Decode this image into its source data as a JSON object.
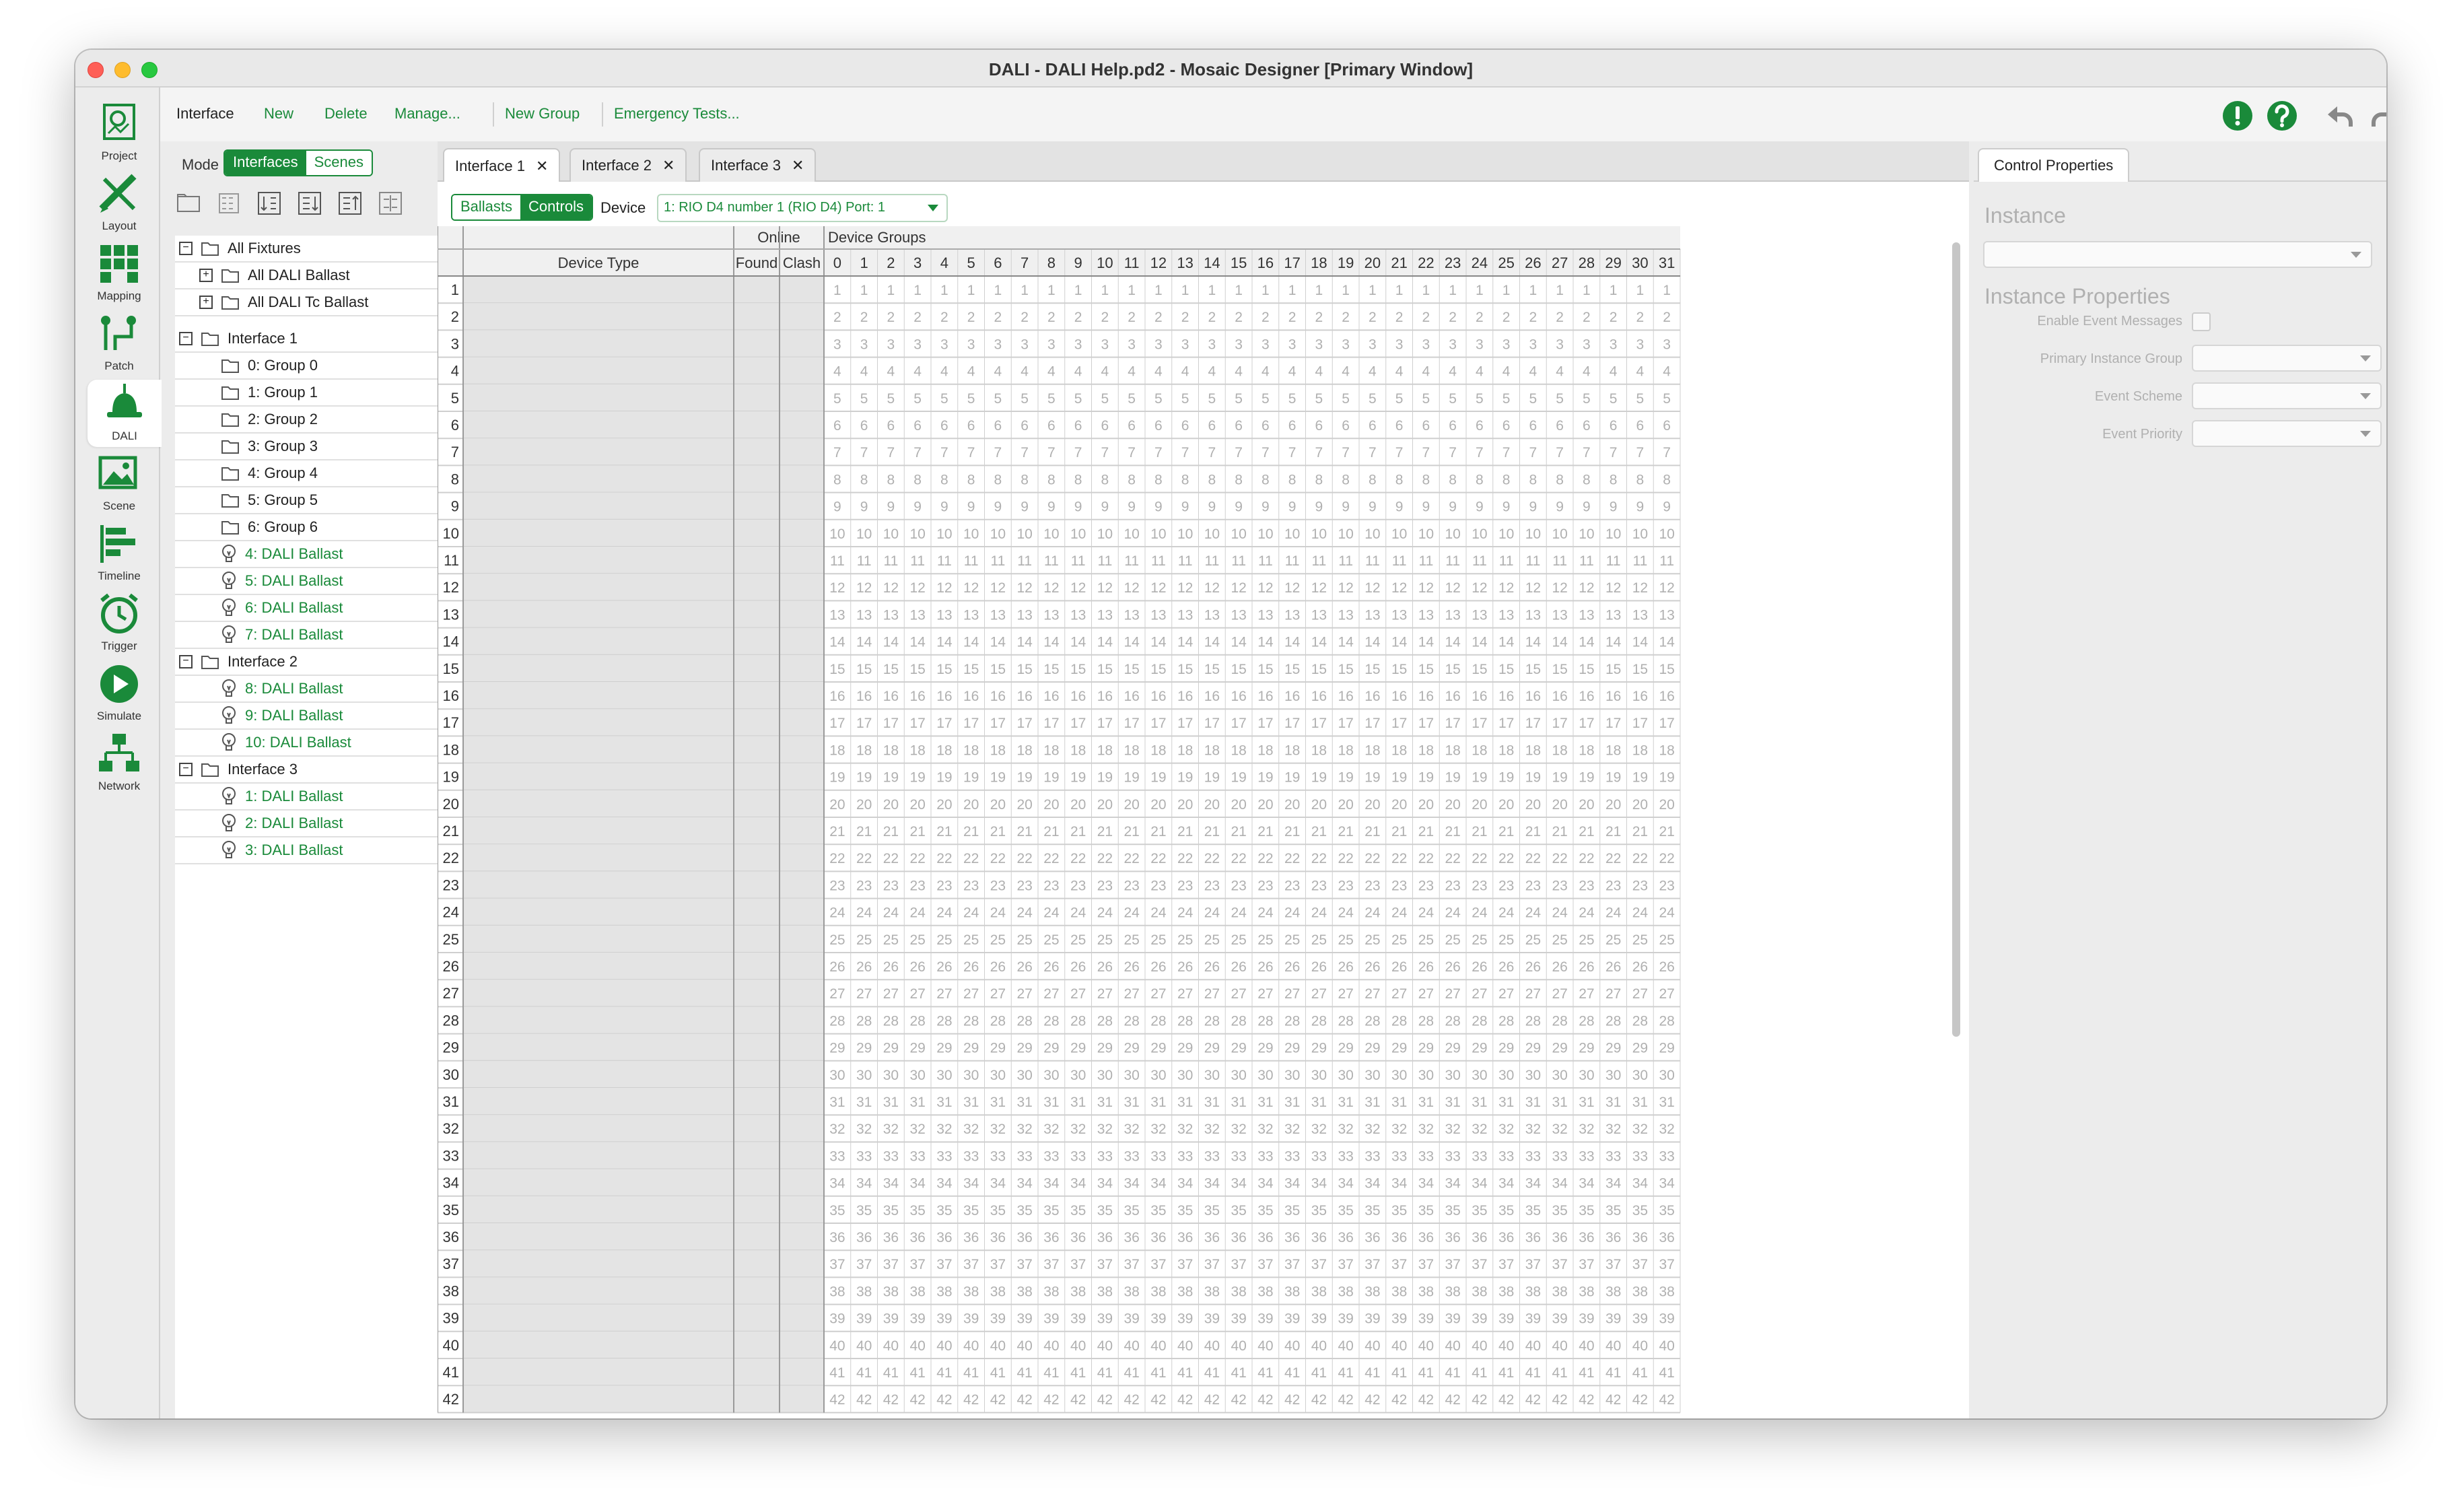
{
  "window": {
    "title": "DALI - DALI Help.pd2 - Mosaic Designer [Primary Window]"
  },
  "toolbar": {
    "section_label": "Interface",
    "new_label": "New",
    "delete_label": "Delete",
    "manage_label": "Manage...",
    "new_group_label": "New Group",
    "emergency_label": "Emergency Tests..."
  },
  "modes": [
    {
      "label": "Project",
      "icon": "project-icon"
    },
    {
      "label": "Layout",
      "icon": "layout-icon"
    },
    {
      "label": "Mapping",
      "icon": "mapping-icon"
    },
    {
      "label": "Patch",
      "icon": "patch-icon"
    },
    {
      "label": "DALI",
      "icon": "dali-icon"
    },
    {
      "label": "Scene",
      "icon": "scene-icon"
    },
    {
      "label": "Timeline",
      "icon": "timeline-icon"
    },
    {
      "label": "Trigger",
      "icon": "trigger-icon"
    },
    {
      "label": "Simulate",
      "icon": "simulate-icon"
    },
    {
      "label": "Network",
      "icon": "network-icon"
    }
  ],
  "left_panel": {
    "mode_label": "Mode",
    "mode_options": [
      "Interfaces",
      "Scenes"
    ],
    "mode_selected": "Interfaces",
    "tree": [
      {
        "label": "All Fixtures",
        "level": 0,
        "type": "folder",
        "exp": "minus"
      },
      {
        "label": "All DALI Ballast",
        "level": 1,
        "type": "folder",
        "exp": "plus"
      },
      {
        "label": "All DALI Tc Ballast",
        "level": 1,
        "type": "folder",
        "exp": "plus"
      },
      {
        "label": "Interface 1",
        "level": 0,
        "type": "folder",
        "exp": "minus",
        "gap": true
      },
      {
        "label": "0: Group 0",
        "level": 1,
        "type": "folder"
      },
      {
        "label": "1: Group 1",
        "level": 1,
        "type": "folder"
      },
      {
        "label": "2: Group 2",
        "level": 1,
        "type": "folder"
      },
      {
        "label": "3: Group 3",
        "level": 1,
        "type": "folder"
      },
      {
        "label": "4: Group 4",
        "level": 1,
        "type": "folder"
      },
      {
        "label": "5: Group 5",
        "level": 1,
        "type": "folder"
      },
      {
        "label": "6: Group 6",
        "level": 1,
        "type": "folder"
      },
      {
        "label": "4: DALI Ballast",
        "level": 1,
        "type": "bulb"
      },
      {
        "label": "5: DALI Ballast",
        "level": 1,
        "type": "bulb"
      },
      {
        "label": "6: DALI Ballast",
        "level": 1,
        "type": "bulb"
      },
      {
        "label": "7: DALI Ballast",
        "level": 1,
        "type": "bulb"
      },
      {
        "label": "Interface 2",
        "level": 0,
        "type": "folder",
        "exp": "minus"
      },
      {
        "label": "8: DALI Ballast",
        "level": 1,
        "type": "bulb"
      },
      {
        "label": "9: DALI Ballast",
        "level": 1,
        "type": "bulb"
      },
      {
        "label": "10: DALI Ballast",
        "level": 1,
        "type": "bulb"
      },
      {
        "label": "Interface 3",
        "level": 0,
        "type": "folder",
        "exp": "minus"
      },
      {
        "label": "1: DALI Ballast",
        "level": 1,
        "type": "bulb"
      },
      {
        "label": "2: DALI Ballast",
        "level": 1,
        "type": "bulb"
      },
      {
        "label": "3: DALI Ballast",
        "level": 1,
        "type": "bulb"
      }
    ]
  },
  "tabs": [
    "Interface 1",
    "Interface 2",
    "Interface 3"
  ],
  "device_bar": {
    "view_options": [
      "Ballasts",
      "Controls"
    ],
    "view_selected": "Controls",
    "device_label": "Device",
    "device_value": "1: RIO D4 number 1 (RIO D4) Port: 1"
  },
  "grid": {
    "online_header": "Online",
    "device_groups_header": "Device Groups",
    "device_type_header": "Device Type",
    "found_header": "Found",
    "clash_header": "Clash",
    "row_start": 1,
    "row_count": 42,
    "group_count": 32
  },
  "right_panel": {
    "tab_label": "Control Properties",
    "instance_heading": "Instance",
    "instance_props_heading": "Instance Properties",
    "enable_event_label": "Enable Event Messages",
    "primary_group_label": "Primary Instance Group",
    "event_scheme_label": "Event Scheme",
    "event_priority_label": "Event Priority"
  },
  "colors": {
    "accent": "#1a8a3a",
    "warning": "#1a8a3a",
    "grid_line": "#bdbdbd",
    "grid_text": "#b0b0b0"
  }
}
